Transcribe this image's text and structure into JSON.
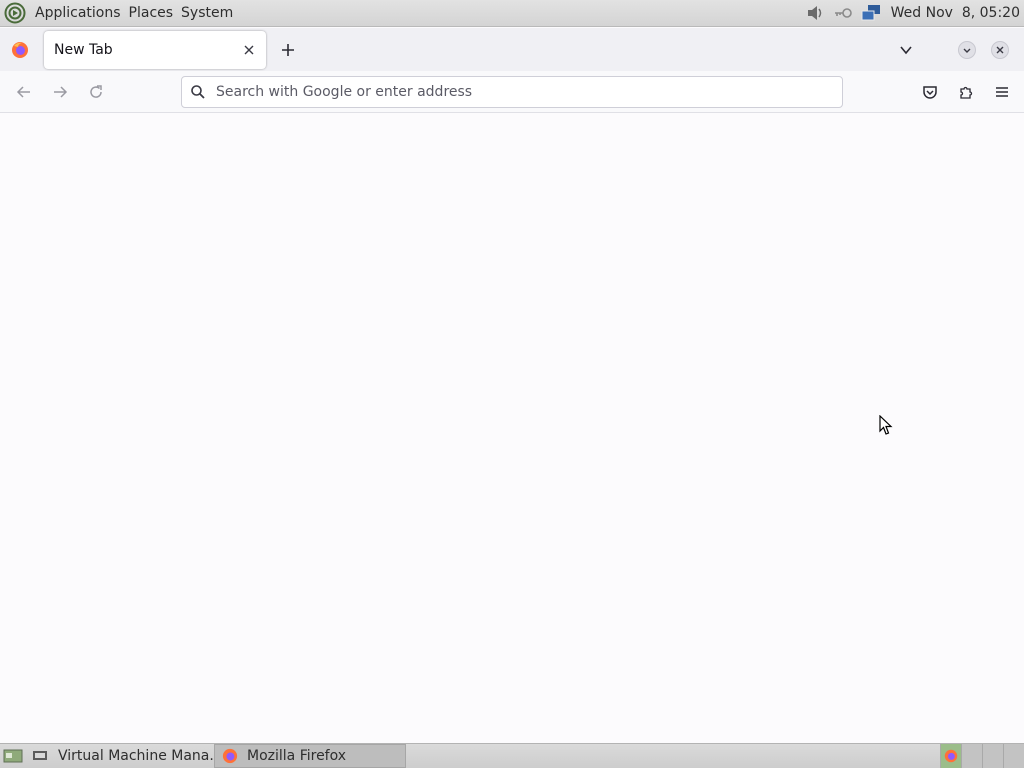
{
  "top_panel": {
    "menus": [
      "Applications",
      "Places",
      "System"
    ],
    "clock": "Wed Nov  8, 05:20",
    "tray_icons": [
      "volume-icon",
      "key-icon",
      "network-icon"
    ]
  },
  "browser": {
    "tab": {
      "label": "New Tab"
    },
    "url_bar": {
      "placeholder": "Search with Google or enter address",
      "value": ""
    }
  },
  "taskbar": {
    "items": [
      {
        "label": "Virtual Machine Mana...",
        "icon": "vm-manager-icon",
        "active": false
      },
      {
        "label": "Mozilla Firefox",
        "icon": "firefox-icon",
        "active": true
      }
    ]
  },
  "colors": {
    "accent": "#0060df",
    "firefox_orange": "#ff7139",
    "firefox_purple": "#9059ff",
    "page_background": "#fcfbfd"
  }
}
